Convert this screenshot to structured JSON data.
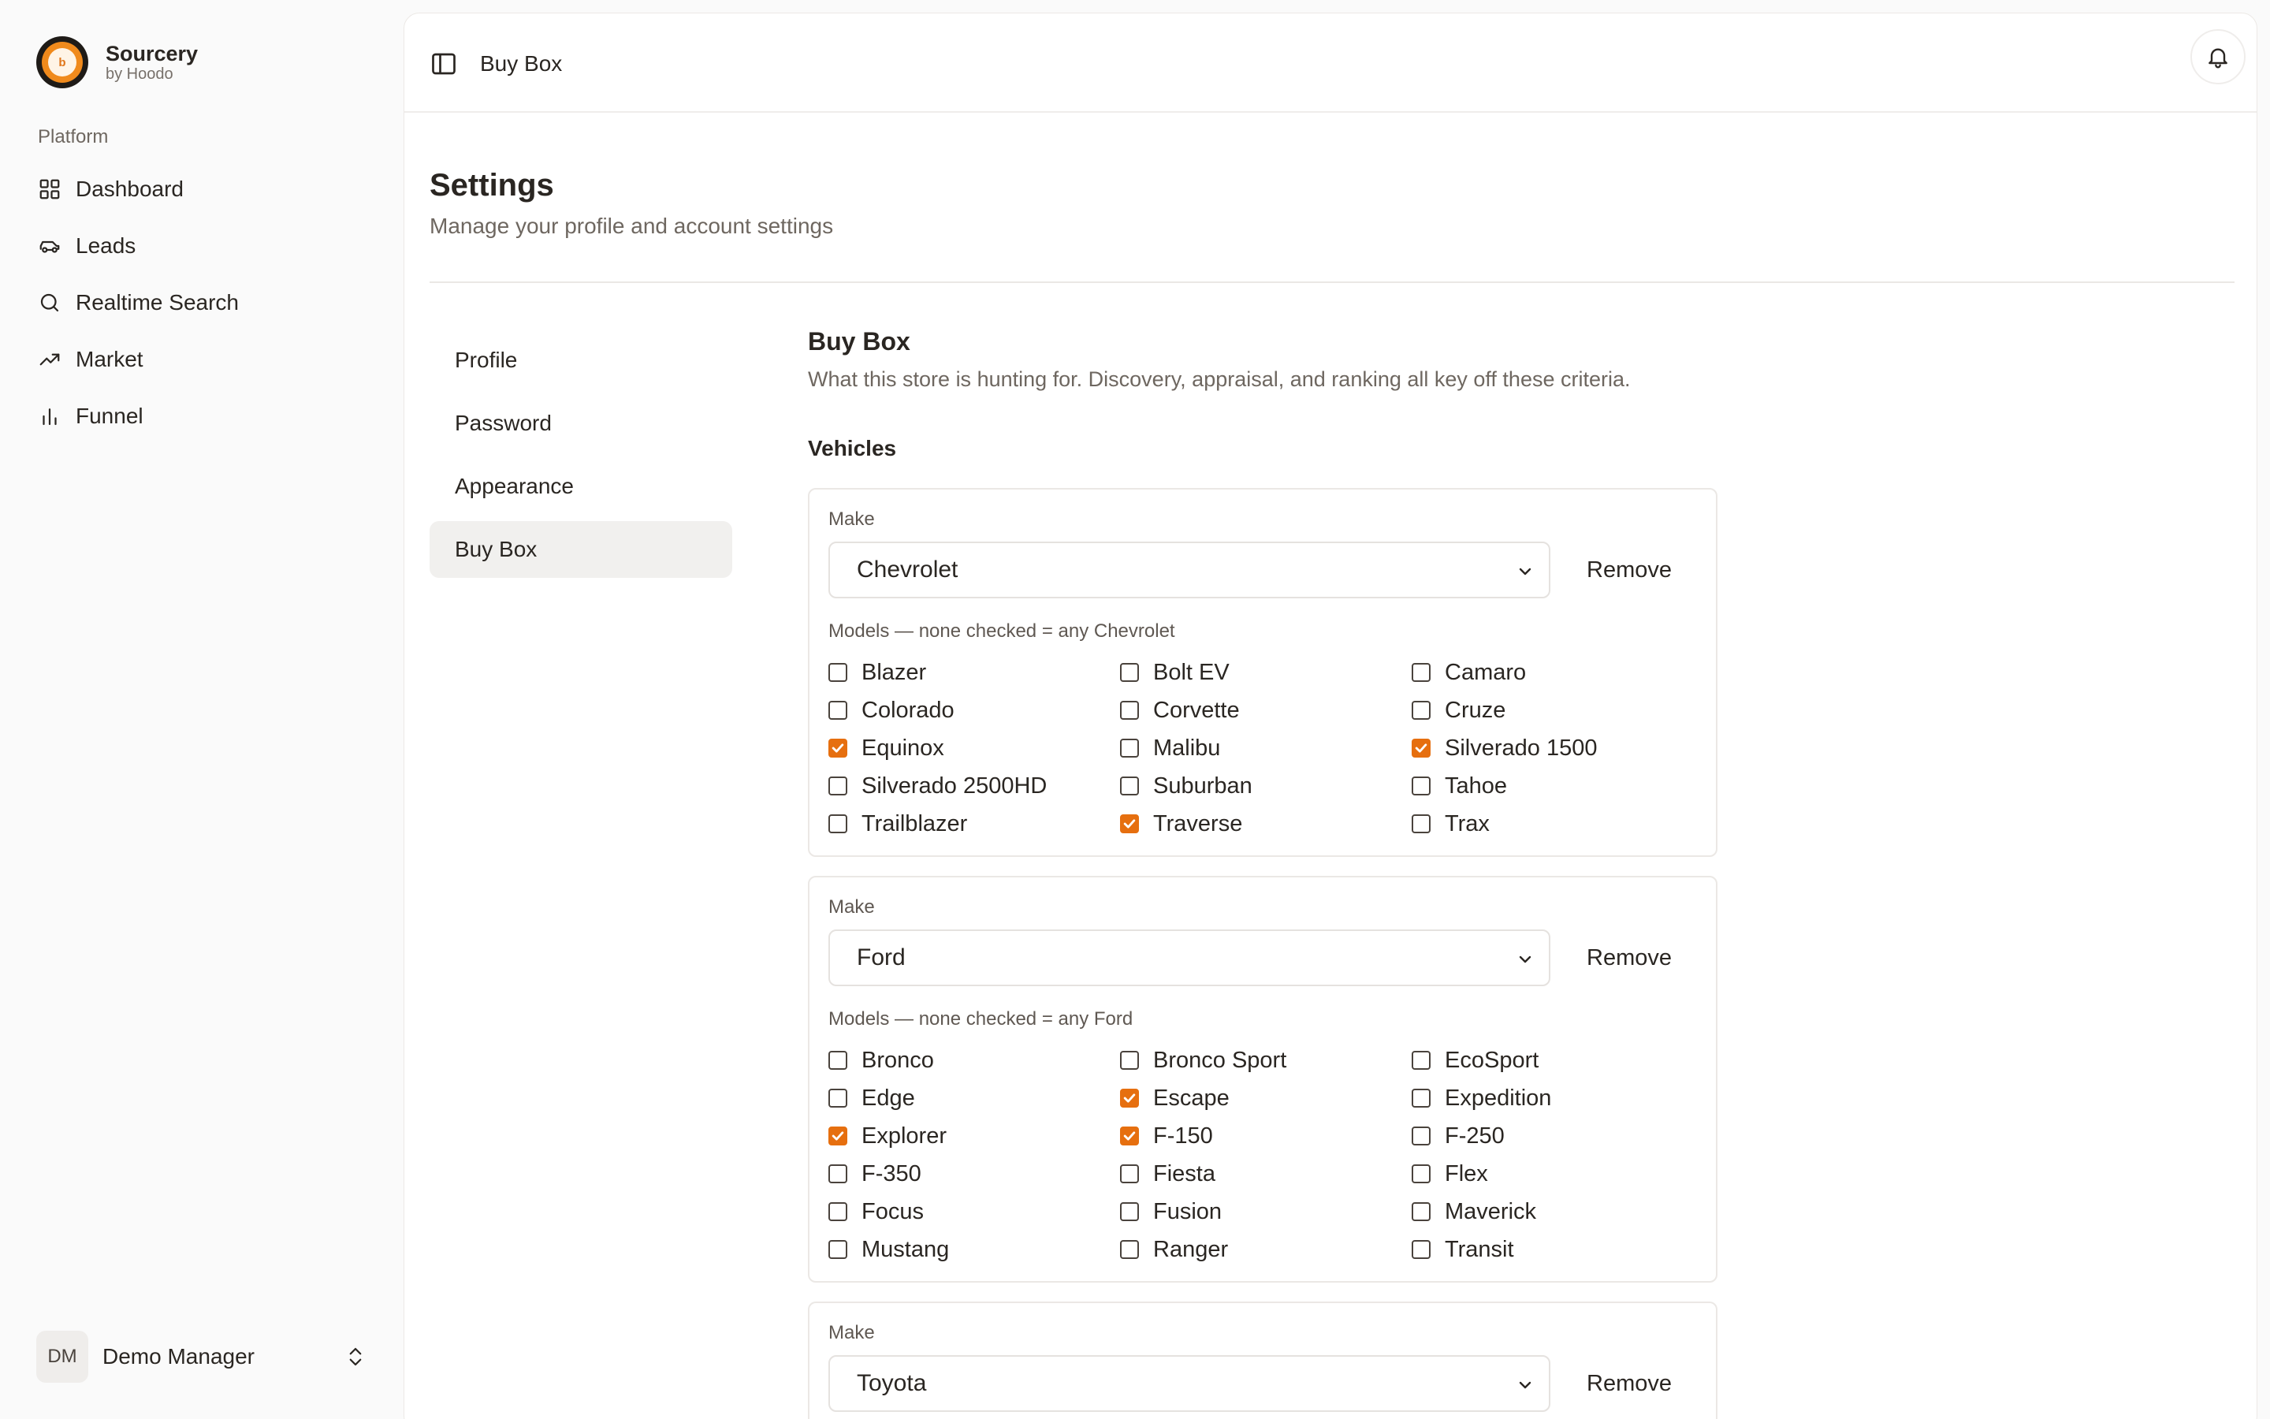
{
  "brand": {
    "name": "Sourcery",
    "sub": "by Hoodo",
    "logo_letter": "b"
  },
  "sidebar": {
    "group_label": "Platform",
    "items": [
      {
        "label": "Dashboard",
        "icon": "grid-icon"
      },
      {
        "label": "Leads",
        "icon": "car-icon"
      },
      {
        "label": "Realtime Search",
        "icon": "search-icon"
      },
      {
        "label": "Market",
        "icon": "trending-up-icon"
      },
      {
        "label": "Funnel",
        "icon": "bar-chart-icon"
      }
    ],
    "user": {
      "initials": "DM",
      "name": "Demo Manager"
    }
  },
  "topbar": {
    "title": "Buy Box"
  },
  "page": {
    "title": "Settings",
    "subtitle": "Manage your profile and account settings"
  },
  "subnav": {
    "items": [
      "Profile",
      "Password",
      "Appearance",
      "Buy Box"
    ],
    "active": "Buy Box"
  },
  "buybox": {
    "title": "Buy Box",
    "description": "What this store is hunting for. Discovery, appraisal, and ranking all key off these criteria.",
    "vehicles_label": "Vehicles",
    "make_label": "Make",
    "remove_label": "Remove",
    "makes": [
      {
        "make": "Chevrolet",
        "models_label": "Models — none checked = any Chevrolet",
        "models": [
          {
            "name": "Blazer",
            "checked": false
          },
          {
            "name": "Bolt EV",
            "checked": false
          },
          {
            "name": "Camaro",
            "checked": false
          },
          {
            "name": "Colorado",
            "checked": false
          },
          {
            "name": "Corvette",
            "checked": false
          },
          {
            "name": "Cruze",
            "checked": false
          },
          {
            "name": "Equinox",
            "checked": true
          },
          {
            "name": "Malibu",
            "checked": false
          },
          {
            "name": "Silverado 1500",
            "checked": true
          },
          {
            "name": "Silverado 2500HD",
            "checked": false
          },
          {
            "name": "Suburban",
            "checked": false
          },
          {
            "name": "Tahoe",
            "checked": false
          },
          {
            "name": "Trailblazer",
            "checked": false
          },
          {
            "name": "Traverse",
            "checked": true
          },
          {
            "name": "Trax",
            "checked": false
          }
        ]
      },
      {
        "make": "Ford",
        "models_label": "Models — none checked = any Ford",
        "models": [
          {
            "name": "Bronco",
            "checked": false
          },
          {
            "name": "Bronco Sport",
            "checked": false
          },
          {
            "name": "EcoSport",
            "checked": false
          },
          {
            "name": "Edge",
            "checked": false
          },
          {
            "name": "Escape",
            "checked": true
          },
          {
            "name": "Expedition",
            "checked": false
          },
          {
            "name": "Explorer",
            "checked": true
          },
          {
            "name": "F-150",
            "checked": true
          },
          {
            "name": "F-250",
            "checked": false
          },
          {
            "name": "F-350",
            "checked": false
          },
          {
            "name": "Fiesta",
            "checked": false
          },
          {
            "name": "Flex",
            "checked": false
          },
          {
            "name": "Focus",
            "checked": false
          },
          {
            "name": "Fusion",
            "checked": false
          },
          {
            "name": "Maverick",
            "checked": false
          },
          {
            "name": "Mustang",
            "checked": false
          },
          {
            "name": "Ranger",
            "checked": false
          },
          {
            "name": "Transit",
            "checked": false
          }
        ]
      },
      {
        "make": "Toyota",
        "models_label": "",
        "models": []
      }
    ]
  },
  "colors": {
    "accent": "#e66f0f",
    "brand_orange": "#f08a1c"
  }
}
